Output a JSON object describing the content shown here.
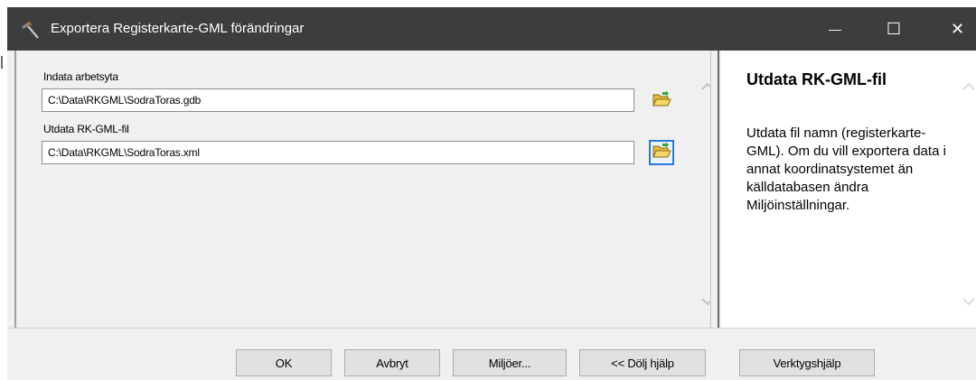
{
  "window": {
    "title": "Exportera Registerkarte-GML förändringar",
    "controls": {
      "minimize": "—",
      "maximize": "☐",
      "close": "✕"
    }
  },
  "fields": [
    {
      "label": "Indata arbetsyta",
      "value": "C:\\Data\\RKGML\\SodraToras.gdb"
    },
    {
      "label": "Utdata RK-GML-fil",
      "value": "C:\\Data\\RKGML\\SodraToras.xml"
    }
  ],
  "help": {
    "title": "Utdata RK-GML-fil",
    "body": "Utdata fil namn (registerkarte-GML). Om du vill exportera data i annat koordinatsystemet än källdatabasen ändra Miljöinställningar."
  },
  "buttons": {
    "ok": "OK",
    "cancel": "Avbryt",
    "environments": "Miljöer...",
    "hide_help": "<< Dölj hjälp",
    "tool_help": "Verktygshjälp"
  },
  "icons": {
    "title_icon": "hammer-icon",
    "browse": "open-folder-icon",
    "scroll_up": "chevron-up-icon",
    "scroll_down": "chevron-down-icon"
  },
  "colors": {
    "titlebar": "#3d3d3d",
    "dialog_bg": "#f0f0f0",
    "focus_border": "#2a7bd6",
    "folder_yellow": "#f5c542"
  }
}
